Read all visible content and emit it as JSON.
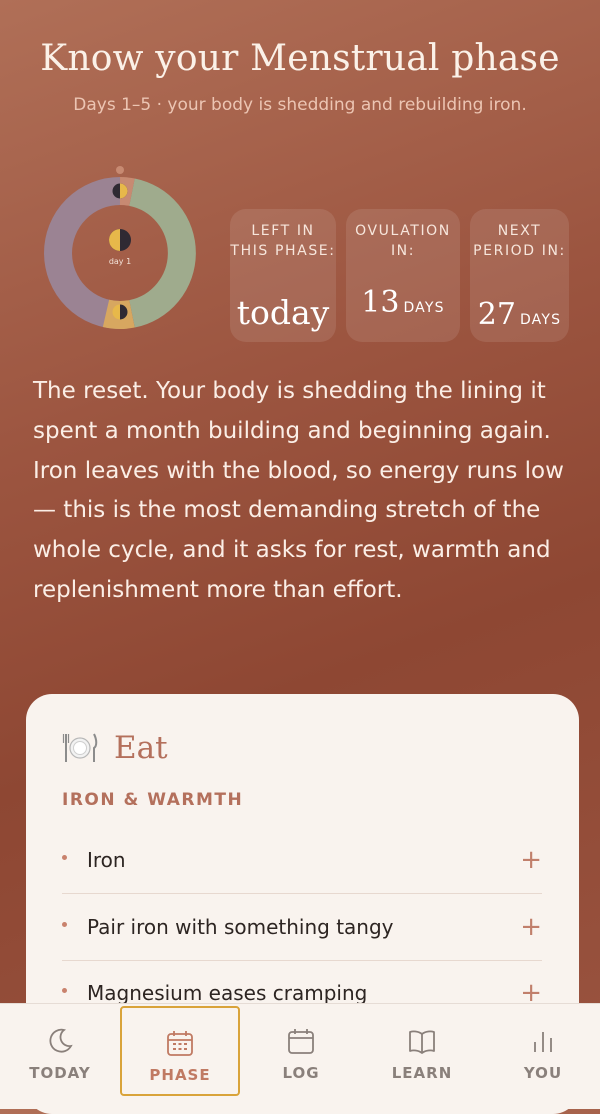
{
  "header": {
    "title": "Know your Menstrual phase",
    "subtitle": "Days 1–5 · your body is shedding and rebuilding iron."
  },
  "ring": {
    "center_label": "day 1",
    "colors": {
      "menstrual": "#c78a72",
      "follicular": "#9fab8d",
      "ovulation": "#d7a760",
      "luteal": "#9b8393",
      "moon_gold": "#e7b84a",
      "moon_dark": "#2f2a33"
    }
  },
  "stats": [
    {
      "label": "LEFT IN THIS PHASE:",
      "value": "today",
      "unit": ""
    },
    {
      "label": "OVULATION IN:",
      "value": "13",
      "unit": "DAYS"
    },
    {
      "label": "NEXT PERIOD IN:",
      "value": "27",
      "unit": "DAYS"
    }
  ],
  "description": "The reset. Your body is shedding the lining it spent a month building and beginning again. Iron leaves with the blood, so energy runs low — this is the most demanding stretch of the whole cycle, and it asks for rest, warmth and replenishment more than effort.",
  "card": {
    "icon": "plate-icon",
    "title": "Eat",
    "subtitle": "IRON & WARMTH",
    "items": [
      {
        "label": "Iron"
      },
      {
        "label": "Pair iron with something tangy"
      },
      {
        "label": "Magnesium eases cramping"
      }
    ],
    "expand_symbol": "+"
  },
  "nav": {
    "items": [
      {
        "label": "TODAY",
        "icon": "moon-icon"
      },
      {
        "label": "PHASE",
        "icon": "calendar-grid-icon",
        "active": true
      },
      {
        "label": "LOG",
        "icon": "calendar-icon"
      },
      {
        "label": "LEARN",
        "icon": "book-icon"
      },
      {
        "label": "YOU",
        "icon": "bar-chart-icon"
      }
    ]
  }
}
